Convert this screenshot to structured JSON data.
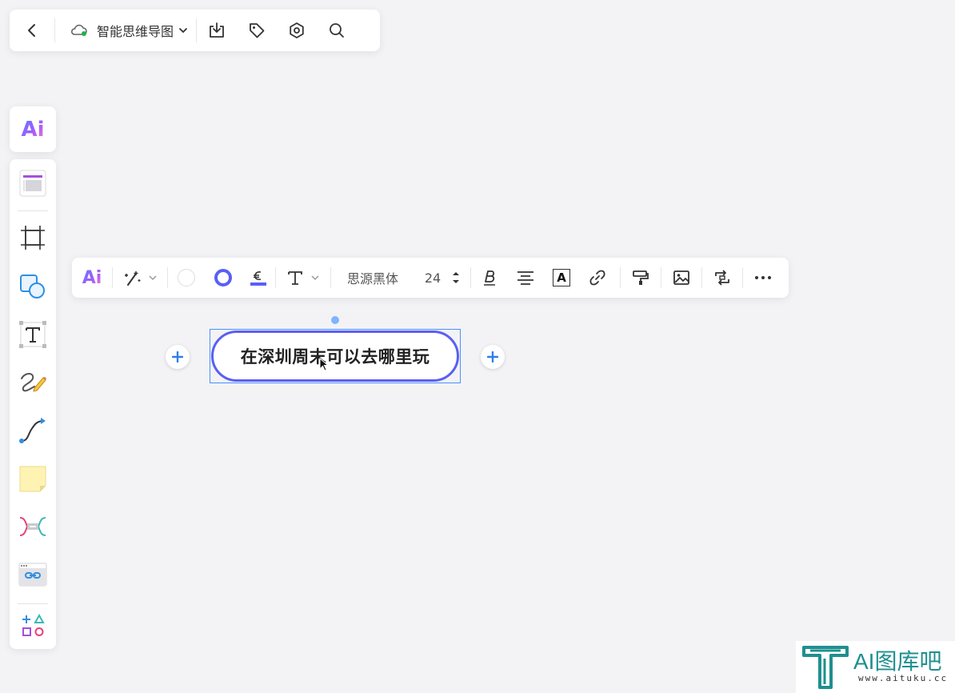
{
  "topbar": {
    "title": "智能思维导图"
  },
  "ai_button": {
    "label": "Ai"
  },
  "format_toolbar": {
    "ai_label": "Ai",
    "font_name": "思源黑体",
    "font_size": "24",
    "text_color_label": "A"
  },
  "node": {
    "text": "在深圳周末可以去哪里玩"
  },
  "watermark": {
    "title": "AI图库吧",
    "url": "www.aituku.cc"
  },
  "colors": {
    "accent": "#5a5ff5",
    "selection": "#4a90ff",
    "add_button": "#2f7fe8",
    "cloud_status": "#22b14c"
  },
  "icons": {
    "topbar": [
      "back-arrow-icon",
      "cloud-icon",
      "chevron-down-icon",
      "download-icon",
      "tag-icon",
      "gear-icon",
      "search-icon"
    ],
    "left_toolbar": [
      "template-icon",
      "frame-icon",
      "shape-icon",
      "text-icon",
      "pen-icon",
      "connector-icon",
      "sticky-note-icon",
      "mindmap-icon",
      "link-card-icon",
      "more-shapes-icon"
    ]
  }
}
